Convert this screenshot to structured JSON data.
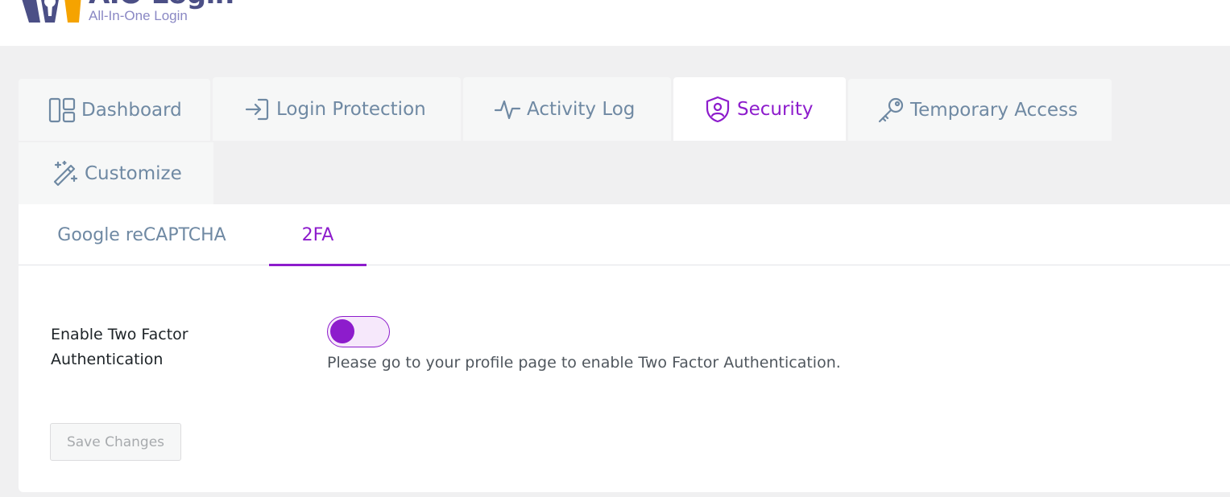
{
  "brand": {
    "title": "AIO Login",
    "subtitle": "All-In-One Login",
    "colors": {
      "primary": "#8d1ccc",
      "logo_dark": "#4b4f86",
      "logo_light": "#8a88c4"
    }
  },
  "tabs": [
    {
      "label": "Dashboard",
      "icon": "dashboard-icon",
      "active": false
    },
    {
      "label": "Login Protection",
      "icon": "login-arrow-icon",
      "active": false
    },
    {
      "label": "Activity Log",
      "icon": "activity-icon",
      "active": false
    },
    {
      "label": "Security",
      "icon": "shield-user-icon",
      "active": true
    },
    {
      "label": "Temporary Access",
      "icon": "key-icon",
      "active": false
    },
    {
      "label": "Customize",
      "icon": "magic-wand-icon",
      "active": false
    }
  ],
  "subtabs": [
    {
      "label": "Google reCAPTCHA",
      "active": false
    },
    {
      "label": "2FA",
      "active": true
    }
  ],
  "twofa": {
    "field_label": "Enable Two Factor Authentication",
    "toggle_state": "on",
    "helper_text": "Please go to your profile page to enable Two Factor Authentication."
  },
  "actions": {
    "save_label": "Save Changes",
    "save_enabled": false
  }
}
